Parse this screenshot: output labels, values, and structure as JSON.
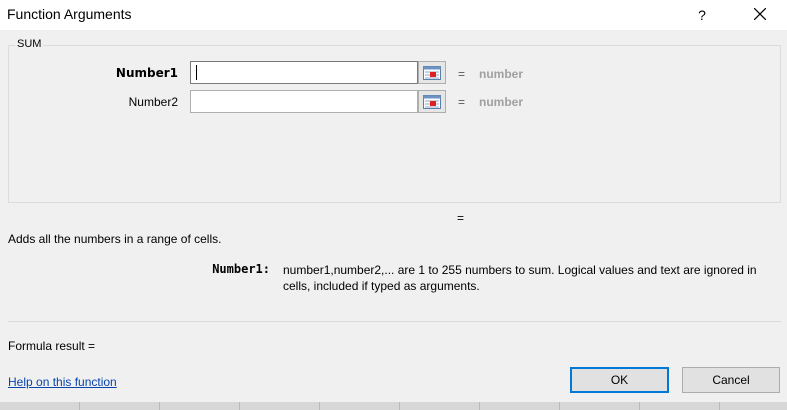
{
  "dialog": {
    "title": "Function Arguments",
    "help_glyph": "?",
    "close_glyph": "close"
  },
  "function": {
    "name": "SUM"
  },
  "arguments": [
    {
      "label": "Number1",
      "value": "",
      "equals": "=",
      "result_hint": "number",
      "active": true
    },
    {
      "label": "Number2",
      "value": "",
      "equals": "=",
      "result_hint": "number",
      "active": false
    }
  ],
  "result_equals": "=",
  "description": "Adds all the numbers in a range of cells.",
  "arg_help": {
    "label": "Number1:",
    "text": "number1,number2,... are 1 to 255 numbers to sum. Logical values and text are ignored in cells, included if typed as arguments."
  },
  "formula_result": "Formula result =",
  "help_link": "Help on this function",
  "buttons": {
    "ok": "OK",
    "cancel": "Cancel"
  },
  "icons": {
    "ref_button": "collapse-dialog-icon",
    "close": "close-icon"
  },
  "colors": {
    "ok_border": "#0078d7",
    "link": "#0645ad",
    "hint": "#a0a0a0"
  }
}
